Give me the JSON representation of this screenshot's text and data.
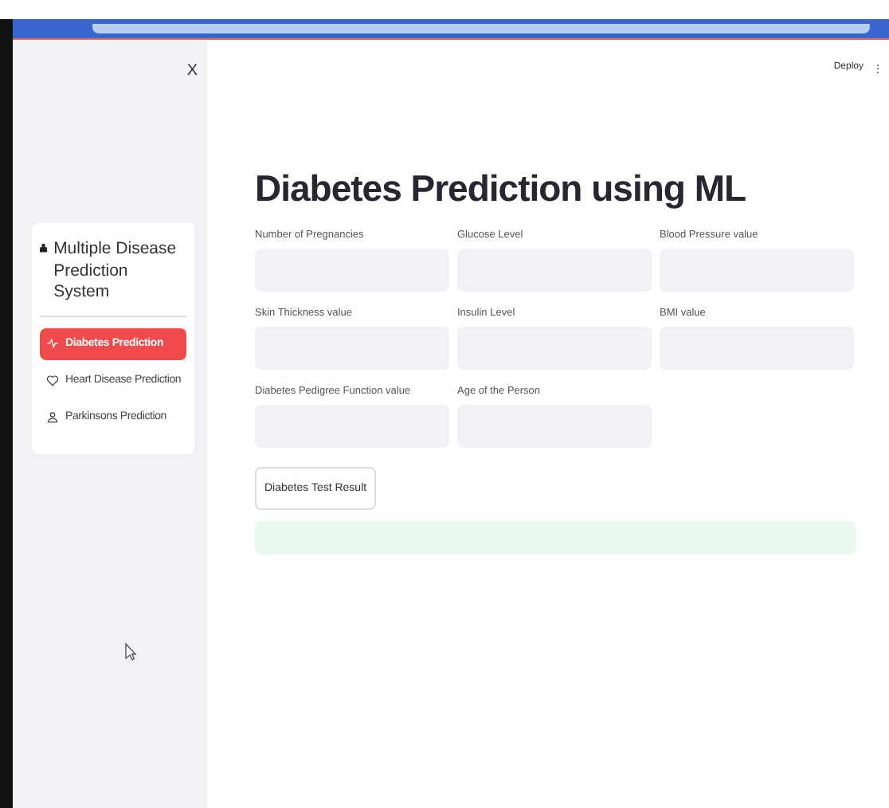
{
  "sidebar": {
    "close": "X",
    "title": "Multiple Disease Prediction System",
    "items": [
      {
        "label": "Diabetes Prediction",
        "selected": true
      },
      {
        "label": "Heart Disease Prediction",
        "selected": false
      },
      {
        "label": "Parkinsons Prediction",
        "selected": false
      }
    ]
  },
  "header": {
    "deploy": "Deploy",
    "menu": "⋮"
  },
  "main": {
    "title": "Diabetes Prediction using ML",
    "fields": [
      {
        "label": "Number of Pregnancies"
      },
      {
        "label": "Glucose Level"
      },
      {
        "label": "Blood Pressure value"
      },
      {
        "label": "Skin Thickness value"
      },
      {
        "label": "Insulin Level"
      },
      {
        "label": "BMI value"
      },
      {
        "label": "Diabetes Pedigree Function value"
      },
      {
        "label": "Age of the Person"
      }
    ],
    "button": "Diabetes Test Result"
  }
}
